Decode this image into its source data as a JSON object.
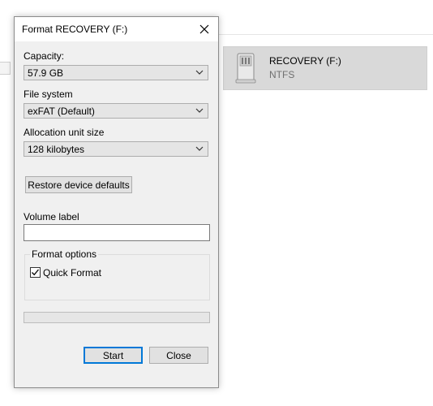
{
  "background": {
    "drive": {
      "name": "RECOVERY (F:)",
      "filesystem": "NTFS",
      "icon": "removable-drive-icon"
    }
  },
  "dialog": {
    "title": "Format RECOVERY (F:)",
    "close_icon": "close-icon",
    "capacity": {
      "label": "Capacity:",
      "value": "57.9 GB"
    },
    "file_system": {
      "label": "File system",
      "value": "exFAT (Default)"
    },
    "allocation_unit": {
      "label": "Allocation unit size",
      "value": "128 kilobytes"
    },
    "restore_defaults_label": "Restore device defaults",
    "volume_label": {
      "label": "Volume label",
      "value": ""
    },
    "format_options": {
      "title": "Format options",
      "quick_format": {
        "label": "Quick Format",
        "checked": true
      }
    },
    "progress": 0,
    "start_label": "Start",
    "close_label": "Close"
  }
}
